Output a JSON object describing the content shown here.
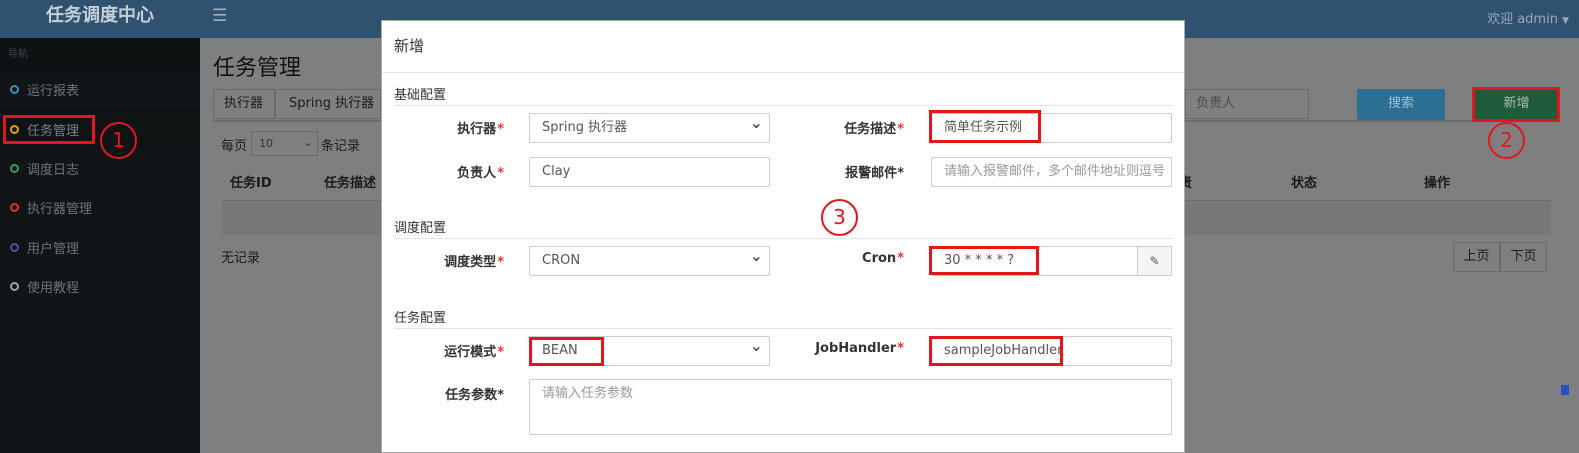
{
  "app": {
    "title": "任务调度中心",
    "welcome": "欢迎 admin",
    "hamburger_icon": "menu-icon"
  },
  "sidebar": {
    "header": "导航",
    "items": [
      {
        "label": "运行报表",
        "dot_color": "#3c8dbc"
      },
      {
        "label": "任务管理",
        "dot_color": "#e5a314"
      },
      {
        "label": "调度日志",
        "dot_color": "#2ea05a"
      },
      {
        "label": "执行器管理",
        "dot_color": "#d73925"
      },
      {
        "label": "用户管理",
        "dot_color": "#5f49a6"
      },
      {
        "label": "使用教程",
        "dot_color": "#a0a0a0"
      }
    ]
  },
  "page": {
    "title": "任务管理",
    "filter_executor_label": "执行器",
    "filter_executor_value": "Spring 执行器",
    "filter_owner_placeholder": "负责人",
    "search_button": "搜索",
    "add_button": "新增",
    "per_page_prefix": "每页",
    "per_page_value": "10",
    "per_page_suffix": "条记录",
    "columns": [
      "任务ID",
      "任务描述",
      "负责人",
      "状态",
      "操作"
    ],
    "empty_text": "无记录",
    "prev": "上页",
    "next": "下页"
  },
  "modal": {
    "title": "新增",
    "sections": {
      "basic": "基础配置",
      "schedule": "调度配置",
      "task": "任务配置"
    },
    "required_mark": "*",
    "fields": {
      "executor": {
        "label": "执行器",
        "value": "Spring 执行器"
      },
      "job_desc": {
        "label": "任务描述",
        "value": "简单任务示例"
      },
      "author": {
        "label": "负责人",
        "value": "Clay"
      },
      "alarm_email": {
        "label": "报警邮件",
        "placeholder": "请输入报警邮件，多个邮件地址则逗号"
      },
      "schedule_type": {
        "label": "调度类型",
        "value": "CRON"
      },
      "cron": {
        "label": "Cron",
        "value": "30 * * * * ?",
        "addon_icon": "edit-icon"
      },
      "run_mode": {
        "label": "运行模式",
        "value": "BEAN"
      },
      "job_handler": {
        "label": "JobHandler",
        "value": "sampleJobHandler"
      },
      "job_param": {
        "label": "任务参数",
        "placeholder": "请输入任务参数"
      }
    }
  },
  "annotations": {
    "step1": "1",
    "step2": "2",
    "step3": "3",
    "color": "#e4151d"
  }
}
